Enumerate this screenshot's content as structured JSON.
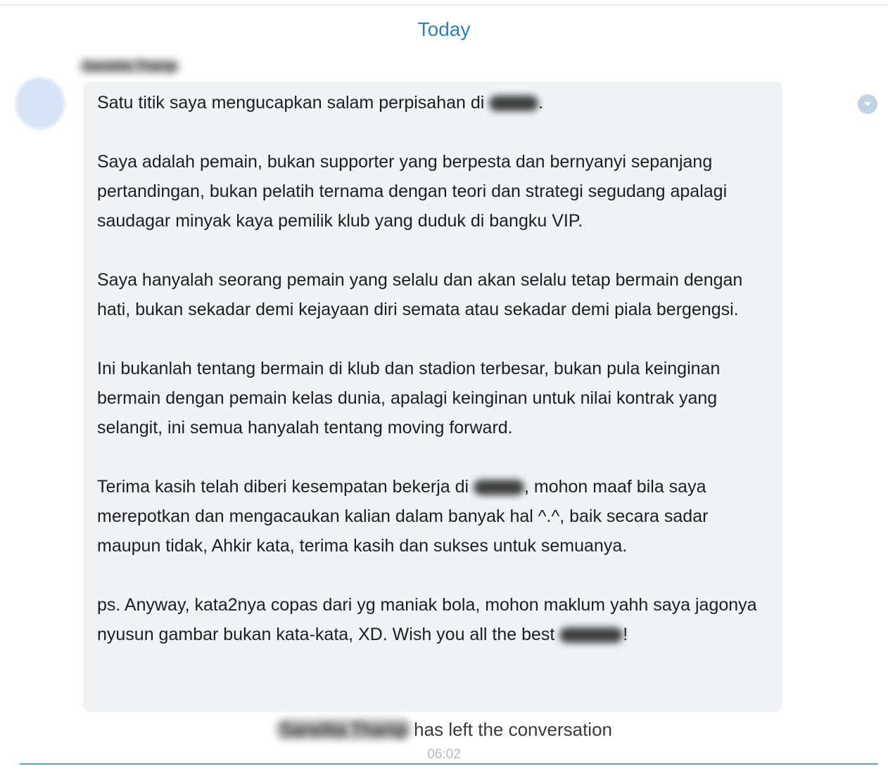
{
  "date_separator": "Today",
  "message": {
    "sender_name": "Sanelita Thariqi",
    "paragraphs": {
      "p1": [
        "Satu titik saya mengucapkan salam perpisahan di ",
        "."
      ],
      "p2": "Saya adalah pemain, bukan supporter yang berpesta dan bernyanyi sepanjang pertandingan, bukan pelatih ternama dengan teori dan strategi segudang apalagi saudagar minyak kaya pemilik klub yang duduk di bangku VIP.",
      "p3": "Saya hanyalah seorang pemain yang selalu dan akan selalu tetap bermain dengan hati, bukan sekadar demi kejayaan diri semata atau sekadar demi piala bergengsi.",
      "p4": "Ini bukanlah tentang bermain di klub dan stadion terbesar, bukan pula keinginan bermain dengan pemain kelas dunia, apalagi keinginan untuk nilai kontrak yang selangit, ini semua hanyalah tentang moving forward.",
      "p5": [
        "Terima kasih telah diberi kesempatan bekerja di ",
        ", mohon maaf bila saya merepotkan dan mengacaukan kalian dalam banyak hal ^.^, baik secara sadar maupun tidak, Ahkir kata, terima kasih dan sukses untuk semuanya."
      ],
      "p6": [
        "ps. Anyway, kata2nya copas dari yg maniak bola, mohon maklum yahh saya jagonya nyusun gambar bukan kata-kata, XD. Wish you all the best ",
        "!"
      ]
    }
  },
  "system_message": {
    "name": "Sanelita Thariqi",
    "text": "has left the conversation",
    "time": "06:02"
  },
  "icons": {
    "menu": "chevron-down-icon",
    "avatar": "avatar"
  },
  "colors": {
    "date": "#2a80c0",
    "bubble": "#f1f3f7",
    "divider": "#4fb3c4"
  }
}
